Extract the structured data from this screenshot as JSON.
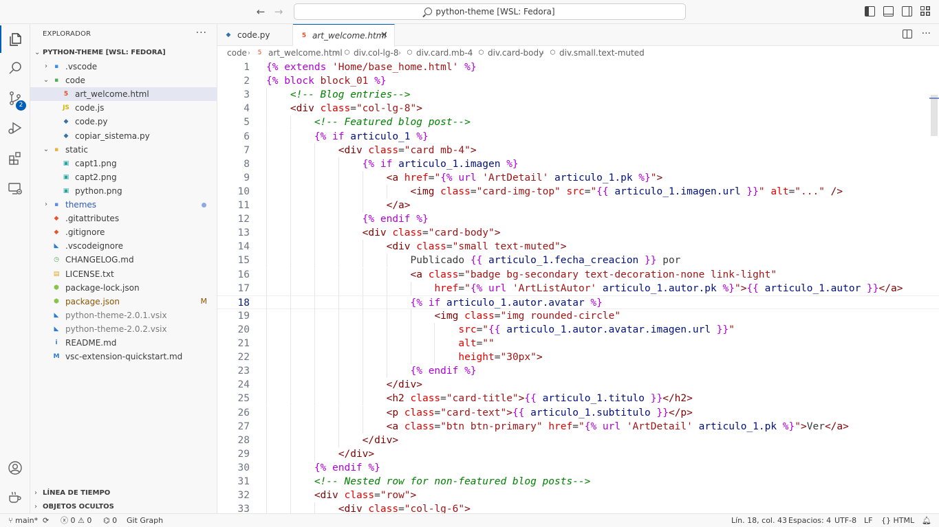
{
  "window": {
    "title": "python-theme [WSL: Fedora]"
  },
  "activity_bar": {
    "items": [
      {
        "name": "explorer",
        "icon": "files-icon"
      },
      {
        "name": "search",
        "icon": "search-icon"
      },
      {
        "name": "source-control",
        "icon": "source-control-icon",
        "badge": "2"
      },
      {
        "name": "run-debug",
        "icon": "run-debug-icon"
      },
      {
        "name": "extensions",
        "icon": "extensions-icon"
      },
      {
        "name": "remote-explorer",
        "icon": "remote-explorer-icon"
      }
    ],
    "bottom": [
      {
        "name": "accounts",
        "icon": "account-icon"
      },
      {
        "name": "manage",
        "icon": "coffee-icon"
      }
    ]
  },
  "sidebar": {
    "title": "EXPLORADOR",
    "root": "PYTHON-THEME [WSL: FEDORA]",
    "tree": [
      {
        "label": ".vscode",
        "depth": 0,
        "kind": "folder",
        "expanded": false,
        "icon": "vscode-folder-icon"
      },
      {
        "label": "code",
        "depth": 0,
        "kind": "folder",
        "expanded": true,
        "icon": "code-folder-icon"
      },
      {
        "label": "art_welcome.html",
        "depth": 1,
        "kind": "file",
        "icon": "html-file-icon",
        "selected": true
      },
      {
        "label": "code.js",
        "depth": 1,
        "kind": "file",
        "icon": "js-file-icon"
      },
      {
        "label": "code.py",
        "depth": 1,
        "kind": "file",
        "icon": "python-file-icon"
      },
      {
        "label": "copiar_sistema.py",
        "depth": 1,
        "kind": "file",
        "icon": "python-file-icon"
      },
      {
        "label": "static",
        "depth": 0,
        "kind": "folder",
        "expanded": true,
        "icon": "folder-icon"
      },
      {
        "label": "capt1.png",
        "depth": 1,
        "kind": "file",
        "icon": "image-file-icon"
      },
      {
        "label": "capt2.png",
        "depth": 1,
        "kind": "file",
        "icon": "image-file-icon"
      },
      {
        "label": "python.png",
        "depth": 1,
        "kind": "file",
        "icon": "image-file-icon"
      },
      {
        "label": "themes",
        "depth": 0,
        "kind": "folder",
        "expanded": false,
        "icon": "themes-folder-icon",
        "modified_dot": true
      },
      {
        "label": ".gitattributes",
        "depth": 0,
        "kind": "file",
        "icon": "git-file-icon"
      },
      {
        "label": ".gitignore",
        "depth": 0,
        "kind": "file",
        "icon": "git-file-icon"
      },
      {
        "label": ".vscodeignore",
        "depth": 0,
        "kind": "file",
        "icon": "vscode-file-icon"
      },
      {
        "label": "CHANGELOG.md",
        "depth": 0,
        "kind": "file",
        "icon": "changelog-file-icon"
      },
      {
        "label": "LICENSE.txt",
        "depth": 0,
        "kind": "file",
        "icon": "license-file-icon"
      },
      {
        "label": "package-lock.json",
        "depth": 0,
        "kind": "file",
        "icon": "node-file-icon"
      },
      {
        "label": "package.json",
        "depth": 0,
        "kind": "file",
        "icon": "node-file-icon",
        "decoration": "M"
      },
      {
        "label": "python-theme-2.0.1.vsix",
        "depth": 0,
        "kind": "file",
        "icon": "vsix-file-icon",
        "muted": true
      },
      {
        "label": "python-theme-2.0.2.vsix",
        "depth": 0,
        "kind": "file",
        "icon": "vsix-file-icon",
        "muted": true
      },
      {
        "label": "README.md",
        "depth": 0,
        "kind": "file",
        "icon": "info-file-icon"
      },
      {
        "label": "vsc-extension-quickstart.md",
        "depth": 0,
        "kind": "file",
        "icon": "markdown-file-icon"
      }
    ],
    "sections": [
      "LÍNEA DE TIEMPO",
      "OBJETOS OCULTOS"
    ]
  },
  "tabs": [
    {
      "label": "code.py",
      "icon": "python-file-icon",
      "active": false
    },
    {
      "label": "art_welcome.html",
      "icon": "html-file-icon",
      "active": true
    }
  ],
  "breadcrumb": [
    "code",
    "art_welcome.html",
    "div.col-lg-8",
    "div.card.mb-4",
    "div.card-body",
    "div.small.text-muted"
  ],
  "editor": {
    "current_line": 18,
    "lines": [
      {
        "n": "1",
        "indent": 0,
        "tokens": [
          [
            "jinja",
            "{% extends "
          ],
          [
            "str",
            "'Home/base_home.html'"
          ],
          [
            "jinja",
            " %}"
          ]
        ]
      },
      {
        "n": "2",
        "indent": 0,
        "tokens": [
          [
            "jinja",
            "{% block "
          ],
          [
            "str",
            "block_01"
          ],
          [
            "jinja",
            " %}"
          ]
        ]
      },
      {
        "n": "3",
        "indent": 1,
        "tokens": [
          [
            "comment",
            "<!-- Blog entries-->"
          ]
        ]
      },
      {
        "n": "4",
        "indent": 1,
        "tokens": [
          [
            "tag",
            "<div "
          ],
          [
            "attr",
            "class"
          ],
          [
            "plain",
            "="
          ],
          [
            "str",
            "\"col-lg-8\""
          ],
          [
            "tag",
            ">"
          ]
        ]
      },
      {
        "n": "5",
        "indent": 2,
        "tokens": [
          [
            "comment",
            "<!-- Featured blog post-->"
          ]
        ]
      },
      {
        "n": "6",
        "indent": 2,
        "tokens": [
          [
            "jinja",
            "{% if "
          ],
          [
            "var",
            "articulo_1"
          ],
          [
            "jinja",
            " %}"
          ]
        ]
      },
      {
        "n": "7",
        "indent": 3,
        "tokens": [
          [
            "tag",
            "<div "
          ],
          [
            "attr",
            "class"
          ],
          [
            "plain",
            "="
          ],
          [
            "str",
            "\"card mb-4\""
          ],
          [
            "tag",
            ">"
          ]
        ]
      },
      {
        "n": "8",
        "indent": 4,
        "tokens": [
          [
            "jinja",
            "{% if "
          ],
          [
            "var",
            "articulo_1.imagen"
          ],
          [
            "jinja",
            " %}"
          ]
        ]
      },
      {
        "n": "9",
        "indent": 5,
        "tokens": [
          [
            "tag",
            "<a "
          ],
          [
            "attr",
            "href"
          ],
          [
            "plain",
            "="
          ],
          [
            "str",
            "\""
          ],
          [
            "jinja",
            "{% url "
          ],
          [
            "str",
            "'ArtDetail'"
          ],
          [
            "var",
            " articulo_1.pk"
          ],
          [
            "jinja",
            " %}"
          ],
          [
            "str",
            "\""
          ],
          [
            "tag",
            ">"
          ]
        ]
      },
      {
        "n": "10",
        "indent": 6,
        "tokens": [
          [
            "tag",
            "<img "
          ],
          [
            "attr",
            "class"
          ],
          [
            "plain",
            "="
          ],
          [
            "str",
            "\"card-img-top\""
          ],
          [
            "attr",
            " src"
          ],
          [
            "plain",
            "="
          ],
          [
            "str",
            "\""
          ],
          [
            "jinja",
            "{{ "
          ],
          [
            "var",
            "articulo_1.imagen.url"
          ],
          [
            "jinja",
            " }}"
          ],
          [
            "str",
            "\""
          ],
          [
            "attr",
            " alt"
          ],
          [
            "plain",
            "="
          ],
          [
            "str",
            "\"...\""
          ],
          [
            "tag",
            " />"
          ]
        ]
      },
      {
        "n": "11",
        "indent": 5,
        "tokens": [
          [
            "tag",
            "</a>"
          ]
        ]
      },
      {
        "n": "12",
        "indent": 4,
        "tokens": [
          [
            "jinja",
            "{% endif %}"
          ]
        ]
      },
      {
        "n": "13",
        "indent": 4,
        "tokens": [
          [
            "tag",
            "<div "
          ],
          [
            "attr",
            "class"
          ],
          [
            "plain",
            "="
          ],
          [
            "str",
            "\"card-body\""
          ],
          [
            "tag",
            ">"
          ]
        ]
      },
      {
        "n": "14",
        "indent": 5,
        "tokens": [
          [
            "tag",
            "<div "
          ],
          [
            "attr",
            "class"
          ],
          [
            "plain",
            "="
          ],
          [
            "str",
            "\"small text-muted\""
          ],
          [
            "tag",
            ">"
          ]
        ]
      },
      {
        "n": "15",
        "indent": 6,
        "tokens": [
          [
            "plain",
            "Publicado "
          ],
          [
            "jinja",
            "{{ "
          ],
          [
            "var",
            "articulo_1.fecha_creacion"
          ],
          [
            "jinja",
            " }}"
          ],
          [
            "plain",
            " por"
          ]
        ]
      },
      {
        "n": "16",
        "indent": 6,
        "tokens": [
          [
            "tag",
            "<a "
          ],
          [
            "attr",
            "class"
          ],
          [
            "plain",
            "="
          ],
          [
            "str",
            "\"badge bg-secondary text-decoration-none link-light\""
          ]
        ]
      },
      {
        "n": "17",
        "indent": 7,
        "tokens": [
          [
            "attr",
            "href"
          ],
          [
            "plain",
            "="
          ],
          [
            "str",
            "\""
          ],
          [
            "jinja",
            "{% url "
          ],
          [
            "str",
            "'ArtListAutor'"
          ],
          [
            "var",
            " articulo_1.autor.pk"
          ],
          [
            "jinja",
            " %}"
          ],
          [
            "str",
            "\""
          ],
          [
            "tag",
            ">"
          ],
          [
            "jinja",
            "{{ "
          ],
          [
            "var",
            "articulo_1.autor"
          ],
          [
            "jinja",
            " }}"
          ],
          [
            "tag",
            "</a>"
          ]
        ]
      },
      {
        "n": "18",
        "indent": 6,
        "tokens": [
          [
            "jinja",
            "{% if "
          ],
          [
            "var",
            "articulo_1.autor.avatar"
          ],
          [
            "jinja",
            " %}"
          ]
        ]
      },
      {
        "n": "19",
        "indent": 7,
        "tokens": [
          [
            "tag",
            "<img "
          ],
          [
            "attr",
            "class"
          ],
          [
            "plain",
            "="
          ],
          [
            "str",
            "\"img rounded-circle\""
          ]
        ]
      },
      {
        "n": "20",
        "indent": 8,
        "tokens": [
          [
            "attr",
            "src"
          ],
          [
            "plain",
            "="
          ],
          [
            "str",
            "\""
          ],
          [
            "jinja",
            "{{ "
          ],
          [
            "var",
            "articulo_1.autor.avatar.imagen.url"
          ],
          [
            "jinja",
            " }}"
          ],
          [
            "str",
            "\""
          ]
        ]
      },
      {
        "n": "21",
        "indent": 8,
        "tokens": [
          [
            "attr",
            "alt"
          ],
          [
            "plain",
            "="
          ],
          [
            "str",
            "\"\""
          ]
        ]
      },
      {
        "n": "22",
        "indent": 8,
        "tokens": [
          [
            "attr",
            "height"
          ],
          [
            "plain",
            "="
          ],
          [
            "str",
            "\"30px\""
          ],
          [
            "tag",
            ">"
          ]
        ]
      },
      {
        "n": "23",
        "indent": 6,
        "tokens": [
          [
            "jinja",
            "{% endif %}"
          ]
        ]
      },
      {
        "n": "24",
        "indent": 5,
        "tokens": [
          [
            "tag",
            "</div>"
          ]
        ]
      },
      {
        "n": "25",
        "indent": 5,
        "tokens": [
          [
            "tag",
            "<h2 "
          ],
          [
            "attr",
            "class"
          ],
          [
            "plain",
            "="
          ],
          [
            "str",
            "\"card-title\""
          ],
          [
            "tag",
            ">"
          ],
          [
            "jinja",
            "{{ "
          ],
          [
            "var",
            "articulo_1.titulo"
          ],
          [
            "jinja",
            " }}"
          ],
          [
            "tag",
            "</h2>"
          ]
        ]
      },
      {
        "n": "26",
        "indent": 5,
        "tokens": [
          [
            "tag",
            "<p "
          ],
          [
            "attr",
            "class"
          ],
          [
            "plain",
            "="
          ],
          [
            "str",
            "\"card-text\""
          ],
          [
            "tag",
            ">"
          ],
          [
            "jinja",
            "{{ "
          ],
          [
            "var",
            "articulo_1.subtitulo"
          ],
          [
            "jinja",
            " }}"
          ],
          [
            "tag",
            "</p>"
          ]
        ]
      },
      {
        "n": "27",
        "indent": 5,
        "tokens": [
          [
            "tag",
            "<a "
          ],
          [
            "attr",
            "class"
          ],
          [
            "plain",
            "="
          ],
          [
            "str",
            "\"btn btn-primary\""
          ],
          [
            "attr",
            " href"
          ],
          [
            "plain",
            "="
          ],
          [
            "str",
            "\""
          ],
          [
            "jinja",
            "{% url "
          ],
          [
            "str",
            "'ArtDetail'"
          ],
          [
            "var",
            " articulo_1.pk"
          ],
          [
            "jinja",
            " %}"
          ],
          [
            "str",
            "\""
          ],
          [
            "tag",
            ">"
          ],
          [
            "plain",
            "Ver"
          ],
          [
            "tag",
            "</a>"
          ]
        ]
      },
      {
        "n": "28",
        "indent": 4,
        "tokens": [
          [
            "tag",
            "</div>"
          ]
        ]
      },
      {
        "n": "29",
        "indent": 3,
        "tokens": [
          [
            "tag",
            "</div>"
          ]
        ]
      },
      {
        "n": "30",
        "indent": 2,
        "tokens": [
          [
            "jinja",
            "{% endif %}"
          ]
        ]
      },
      {
        "n": "31",
        "indent": 2,
        "tokens": [
          [
            "comment",
            "<!-- Nested row for non-featured blog posts-->"
          ]
        ]
      },
      {
        "n": "32",
        "indent": 2,
        "tokens": [
          [
            "tag",
            "<div "
          ],
          [
            "attr",
            "class"
          ],
          [
            "plain",
            "="
          ],
          [
            "str",
            "\"row\""
          ],
          [
            "tag",
            ">"
          ]
        ]
      },
      {
        "n": "33",
        "indent": 3,
        "tokens": [
          [
            "tag",
            "<div "
          ],
          [
            "attr",
            "class"
          ],
          [
            "plain",
            "="
          ],
          [
            "str",
            "\"col-lg-6\""
          ],
          [
            "tag",
            ">"
          ]
        ]
      }
    ]
  },
  "statusbar": {
    "branch": "main*",
    "errors": "0",
    "warnings": "0",
    "ports": "0",
    "git_graph": "Git Graph",
    "position": "Lín. 18, col. 43",
    "spaces": "Espacios: 4",
    "encoding": "UTF-8",
    "eol": "LF",
    "language": "HTML"
  },
  "colors": {
    "accent": "#005fb8",
    "jinja": "#af00db",
    "tag": "#800000",
    "attribute": "#e50000",
    "string": "#a31515",
    "comment": "#008000",
    "variable": "#001080"
  }
}
